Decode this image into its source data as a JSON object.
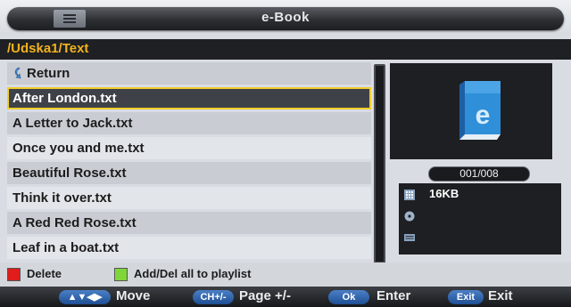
{
  "app_title": "e-Book",
  "path": "/Udska1/Text",
  "files": {
    "return_label": "Return",
    "items": [
      "After London.txt",
      "A Letter to Jack.txt",
      "Once you and me.txt",
      "Beautiful Rose.txt",
      "Think it over.txt",
      "A Red Red Rose.txt",
      "Leaf in a boat.txt"
    ],
    "selected_index": 0
  },
  "preview": {
    "counter": "001/008",
    "size": "16KB",
    "book_icon": "e-book-icon"
  },
  "color_keys": {
    "red_label": "Delete",
    "green_label": "Add/Del all to playlist",
    "red_color": "#e01c1c",
    "green_color": "#7fd63a"
  },
  "nav": {
    "move_key": "▲▼◀▶",
    "move_label": "Move",
    "page_key": "CH+/-",
    "page_label": "Page +/-",
    "ok_key": "Ok",
    "ok_label": "Enter",
    "exit_key": "Exit",
    "exit_label": "Exit"
  },
  "colors": {
    "path": "#f2b21c",
    "selection_border": "#f0cc2a",
    "nav_button": "#2e63ad"
  }
}
